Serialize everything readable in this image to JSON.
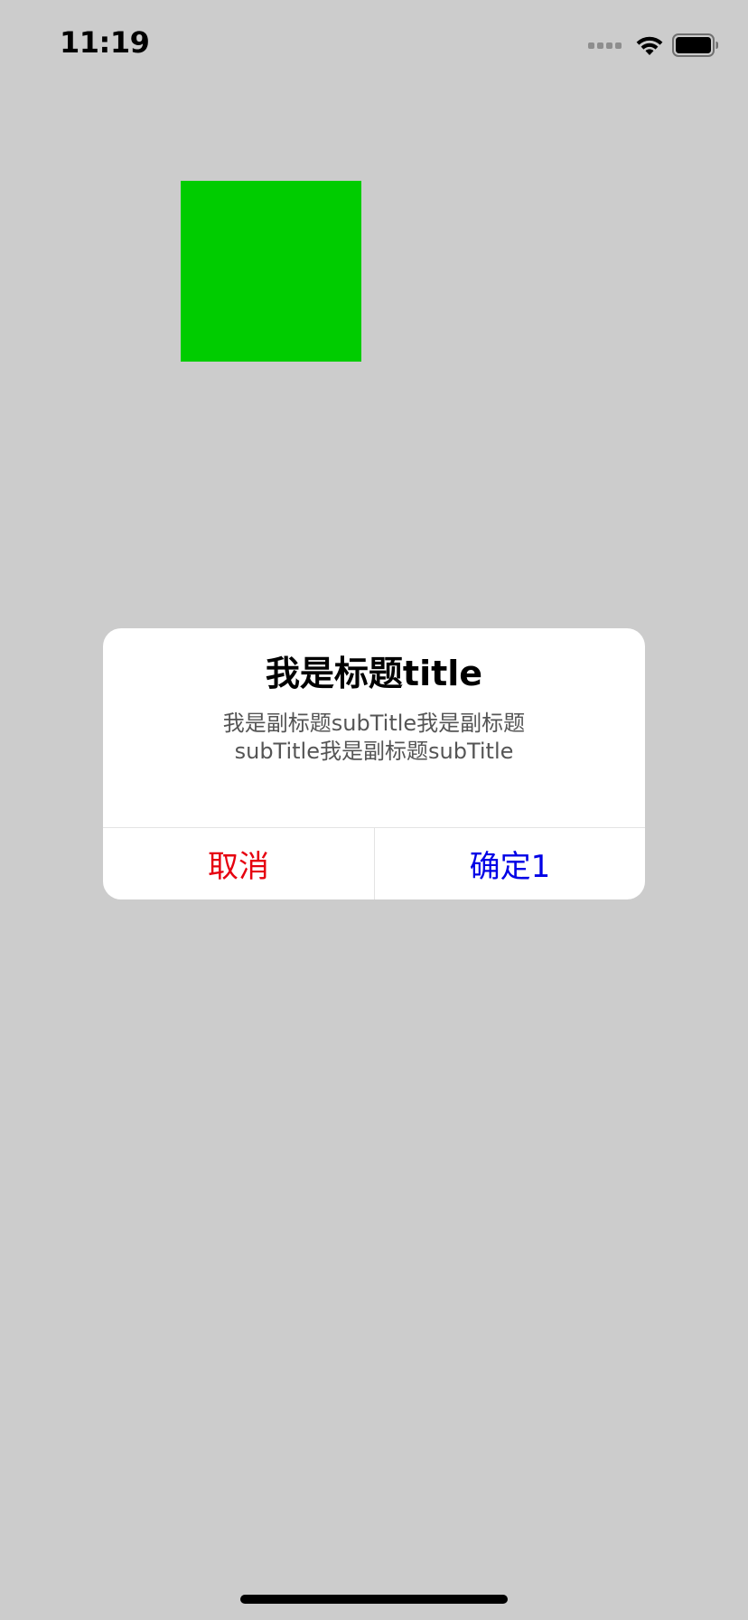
{
  "status_bar": {
    "time": "11:19",
    "signal_icon": "cellular-signal-dots",
    "wifi_icon": "wifi-icon",
    "battery_icon": "battery-full-icon"
  },
  "content": {
    "square_color": "#00cc00"
  },
  "alert": {
    "title": "我是标题title",
    "subtitle": "我是副标题subTitle我是副标题subTitle我是副标题subTitle",
    "cancel_label": "取消",
    "cancel_color": "#e6000f",
    "confirm_label": "确定1",
    "confirm_color": "#0000e6"
  }
}
